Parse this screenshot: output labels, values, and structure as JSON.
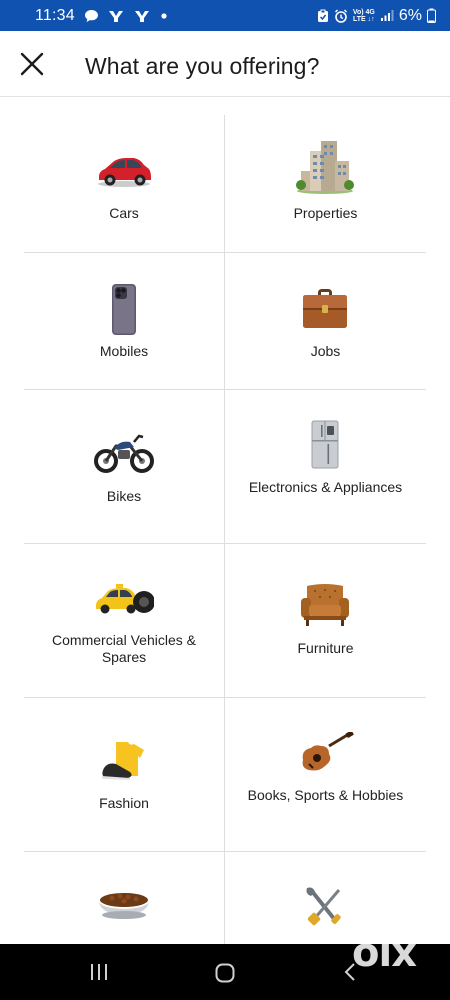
{
  "status_bar": {
    "time": "11:34",
    "battery": "6%",
    "network_top": "Vo) 4G",
    "network_bottom": "LTE ↓↑"
  },
  "header": {
    "title": "What are you offering?"
  },
  "categories": [
    {
      "label": "Cars",
      "icon": "car-icon"
    },
    {
      "label": "Properties",
      "icon": "building-icon"
    },
    {
      "label": "Mobiles",
      "icon": "smartphone-icon"
    },
    {
      "label": "Jobs",
      "icon": "briefcase-icon"
    },
    {
      "label": "Bikes",
      "icon": "motorcycle-icon"
    },
    {
      "label": "Electronics & Appliances",
      "icon": "refrigerator-icon"
    },
    {
      "label": "Commercial Vehicles & Spares",
      "icon": "taxi-tyre-icon"
    },
    {
      "label": "Furniture",
      "icon": "armchair-icon"
    },
    {
      "label": "Fashion",
      "icon": "shirt-shoes-icon"
    },
    {
      "label": "Books, Sports & Hobbies",
      "icon": "guitar-icon"
    },
    {
      "label": "",
      "icon": "pet-bowl-icon"
    },
    {
      "label": "",
      "icon": "tools-icon"
    }
  ],
  "watermark": "olx",
  "colors": {
    "status_bar": "#0f52b0",
    "divider": "#dedede",
    "nav_bar": "#000000"
  }
}
